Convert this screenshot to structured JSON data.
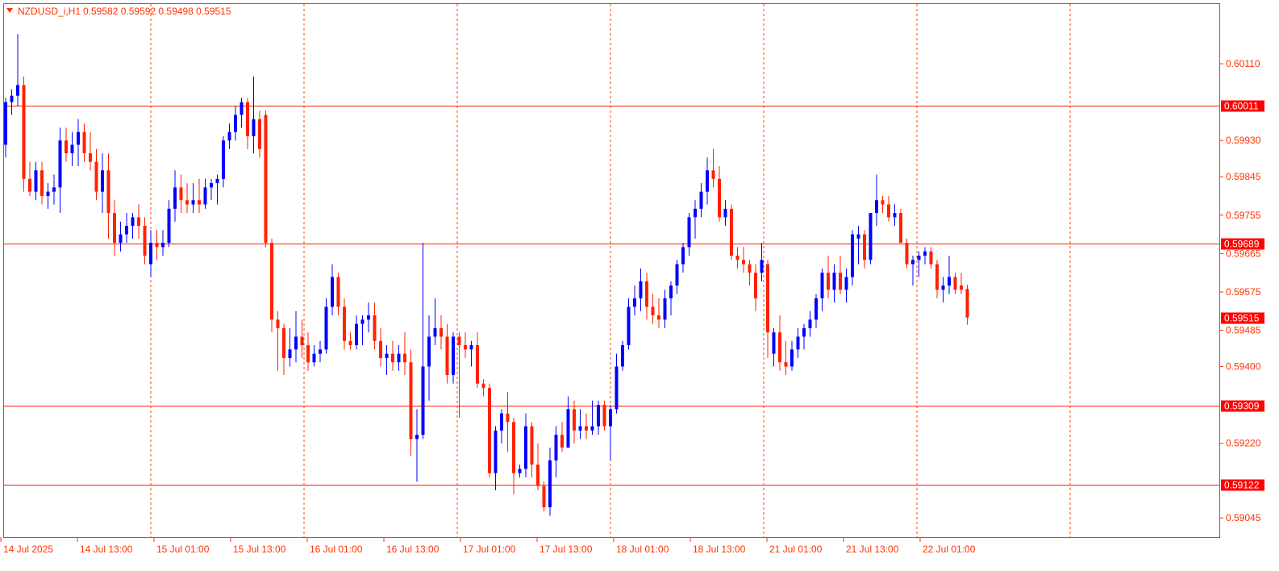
{
  "header": {
    "symbol": "NZDUSD_i,H1",
    "ohlc": "0.59582 0.59592 0.59498 0.59515"
  },
  "colors": {
    "frame": "#ff3300",
    "text": "#ff3300",
    "grid": "#ff4400",
    "bull": "#0000ff",
    "bear": "#ff2200",
    "level_line": "#ff2200",
    "level_label_bg": "#ff0000",
    "level_label_text": "#ffffff"
  },
  "chart_data": {
    "type": "candlestick",
    "timeframe": "H1",
    "ylim": [
      0.59,
      0.6025
    ],
    "y_ticks": [
      "0.60110",
      "0.59930",
      "0.59845",
      "0.59755",
      "0.59665",
      "0.59575",
      "0.59485",
      "0.59400",
      "0.59220",
      "0.59045"
    ],
    "x_labels": [
      "14 Jul 2025",
      "14 Jul 13:00",
      "15 Jul 01:00",
      "15 Jul 13:00",
      "16 Jul 01:00",
      "16 Jul 13:00",
      "17 Jul 01:00",
      "17 Jul 13:00",
      "18 Jul 01:00",
      "18 Jul 13:00",
      "21 Jul 01:00",
      "21 Jul 13:00",
      "22 Jul 01:00"
    ],
    "grid": "vertical dotted",
    "horizontal_levels": [
      {
        "label": "0.60011",
        "value": 0.60011
      },
      {
        "label": "0.59689",
        "value": 0.59689
      },
      {
        "label": "0.59309",
        "value": 0.59309
      },
      {
        "label": "0.59122",
        "value": 0.59122
      }
    ],
    "current_price": {
      "label": "0.59515",
      "value": 0.59515
    },
    "candles": [
      [
        0.5992,
        0.6003,
        0.5989,
        0.6002
      ],
      [
        0.6002,
        0.6005,
        0.5999,
        0.60035
      ],
      [
        0.60035,
        0.6018,
        0.6001,
        0.6006
      ],
      [
        0.6006,
        0.6008,
        0.5981,
        0.5984
      ],
      [
        0.5984,
        0.5988,
        0.598,
        0.5981
      ],
      [
        0.5981,
        0.5988,
        0.5979,
        0.5986
      ],
      [
        0.5986,
        0.5988,
        0.5978,
        0.598
      ],
      [
        0.598,
        0.5983,
        0.5977,
        0.5981
      ],
      [
        0.5981,
        0.5985,
        0.5978,
        0.5982
      ],
      [
        0.5982,
        0.5996,
        0.5976,
        0.5993
      ],
      [
        0.5993,
        0.5996,
        0.5988,
        0.599
      ],
      [
        0.599,
        0.5995,
        0.5987,
        0.5992
      ],
      [
        0.5992,
        0.5998,
        0.5987,
        0.5995
      ],
      [
        0.5995,
        0.5997,
        0.5988,
        0.599
      ],
      [
        0.599,
        0.5995,
        0.5986,
        0.5988
      ],
      [
        0.5988,
        0.5991,
        0.5979,
        0.5981
      ],
      [
        0.5981,
        0.599,
        0.5976,
        0.5986
      ],
      [
        0.5986,
        0.599,
        0.597,
        0.5976
      ],
      [
        0.5976,
        0.5979,
        0.5966,
        0.5969
      ],
      [
        0.5969,
        0.5974,
        0.5967,
        0.5971
      ],
      [
        0.5971,
        0.5976,
        0.5969,
        0.5973
      ],
      [
        0.5973,
        0.5976,
        0.597,
        0.5975
      ],
      [
        0.5975,
        0.5978,
        0.597,
        0.5973
      ],
      [
        0.5973,
        0.5975,
        0.5964,
        0.5966
      ],
      [
        0.5964,
        0.5972,
        0.5961,
        0.5969
      ],
      [
        0.5969,
        0.5972,
        0.5965,
        0.5968
      ],
      [
        0.5968,
        0.5972,
        0.5966,
        0.5969
      ],
      [
        0.5969,
        0.5979,
        0.5968,
        0.5977
      ],
      [
        0.5977,
        0.5986,
        0.5974,
        0.5982
      ],
      [
        0.5982,
        0.5985,
        0.5976,
        0.5979
      ],
      [
        0.5979,
        0.5983,
        0.5976,
        0.5978
      ],
      [
        0.5978,
        0.5983,
        0.5976,
        0.5979
      ],
      [
        0.5979,
        0.5984,
        0.5976,
        0.5978
      ],
      [
        0.5978,
        0.5984,
        0.5977,
        0.5982
      ],
      [
        0.5982,
        0.5984,
        0.5979,
        0.5983
      ],
      [
        0.5983,
        0.5985,
        0.5978,
        0.5984
      ],
      [
        0.5984,
        0.5994,
        0.5982,
        0.5993
      ],
      [
        0.5993,
        0.5997,
        0.5991,
        0.5995
      ],
      [
        0.5995,
        0.6001,
        0.5993,
        0.5999
      ],
      [
        0.5999,
        0.6003,
        0.5996,
        0.6002
      ],
      [
        0.6002,
        0.6003,
        0.5991,
        0.5994
      ],
      [
        0.5994,
        0.6008,
        0.599,
        0.5998
      ],
      [
        0.5998,
        0.6,
        0.5989,
        0.5991
      ],
      [
        0.5999,
        0.6,
        0.5968,
        0.5969
      ],
      [
        0.5969,
        0.597,
        0.5948,
        0.5951
      ],
      [
        0.5951,
        0.5953,
        0.5939,
        0.5949
      ],
      [
        0.5949,
        0.595,
        0.5938,
        0.5942
      ],
      [
        0.5942,
        0.5949,
        0.594,
        0.5944
      ],
      [
        0.5944,
        0.5953,
        0.5941,
        0.5947
      ],
      [
        0.5947,
        0.5951,
        0.5942,
        0.5945
      ],
      [
        0.5945,
        0.5948,
        0.5939,
        0.5941
      ],
      [
        0.5941,
        0.5945,
        0.594,
        0.5943
      ],
      [
        0.5943,
        0.5946,
        0.5941,
        0.5944
      ],
      [
        0.5944,
        0.5956,
        0.5943,
        0.5954
      ],
      [
        0.5954,
        0.5964,
        0.5952,
        0.5961
      ],
      [
        0.5961,
        0.5962,
        0.5952,
        0.5954
      ],
      [
        0.5954,
        0.5956,
        0.5944,
        0.5946
      ],
      [
        0.5946,
        0.5948,
        0.5944,
        0.5945
      ],
      [
        0.5945,
        0.5952,
        0.5944,
        0.595
      ],
      [
        0.595,
        0.5952,
        0.5945,
        0.5951
      ],
      [
        0.5951,
        0.5955,
        0.5948,
        0.5952
      ],
      [
        0.5952,
        0.5955,
        0.5944,
        0.5946
      ],
      [
        0.5946,
        0.5949,
        0.594,
        0.5942
      ],
      [
        0.5942,
        0.5945,
        0.5938,
        0.5943
      ],
      [
        0.5943,
        0.5946,
        0.5939,
        0.5941
      ],
      [
        0.5941,
        0.5945,
        0.5939,
        0.5943
      ],
      [
        0.5943,
        0.5948,
        0.5938,
        0.5941
      ],
      [
        0.5941,
        0.5944,
        0.5919,
        0.5923
      ],
      [
        0.5923,
        0.593,
        0.5913,
        0.5924
      ],
      [
        0.5924,
        0.5969,
        0.5923,
        0.594
      ],
      [
        0.594,
        0.5952,
        0.5932,
        0.5947
      ],
      [
        0.5947,
        0.5956,
        0.5945,
        0.5949
      ],
      [
        0.5949,
        0.5952,
        0.5944,
        0.5947
      ],
      [
        0.5947,
        0.595,
        0.5936,
        0.5938
      ],
      [
        0.5938,
        0.5948,
        0.5936,
        0.5947
      ],
      [
        0.5947,
        0.5948,
        0.5928,
        0.5945
      ],
      [
        0.5945,
        0.5948,
        0.5942,
        0.5944
      ],
      [
        0.5944,
        0.5946,
        0.594,
        0.5945
      ],
      [
        0.5945,
        0.5948,
        0.5935,
        0.5936
      ],
      [
        0.5936,
        0.5937,
        0.5933,
        0.5935
      ],
      [
        0.5935,
        0.5936,
        0.5914,
        0.5915
      ],
      [
        0.5915,
        0.5926,
        0.5911,
        0.5925
      ],
      [
        0.5925,
        0.593,
        0.5922,
        0.5929
      ],
      [
        0.5929,
        0.5934,
        0.592,
        0.5927
      ],
      [
        0.5927,
        0.5928,
        0.591,
        0.5915
      ],
      [
        0.5915,
        0.5917,
        0.5914,
        0.5916
      ],
      [
        0.5916,
        0.5929,
        0.5914,
        0.5926
      ],
      [
        0.5926,
        0.5927,
        0.5914,
        0.5917
      ],
      [
        0.5917,
        0.5922,
        0.5911,
        0.5912
      ],
      [
        0.5912,
        0.5913,
        0.5906,
        0.5907
      ],
      [
        0.5907,
        0.5921,
        0.5905,
        0.5918
      ],
      [
        0.5918,
        0.5926,
        0.5914,
        0.5924
      ],
      [
        0.5924,
        0.5927,
        0.592,
        0.5921
      ],
      [
        0.5921,
        0.5933,
        0.5921,
        0.593
      ],
      [
        0.593,
        0.5932,
        0.5922,
        0.5925
      ],
      [
        0.5925,
        0.593,
        0.5923,
        0.5926
      ],
      [
        0.5926,
        0.5929,
        0.5923,
        0.5925
      ],
      [
        0.5925,
        0.5932,
        0.5924,
        0.5926
      ],
      [
        0.5926,
        0.5932,
        0.5924,
        0.5931
      ],
      [
        0.5931,
        0.5932,
        0.5925,
        0.5926
      ],
      [
        0.5926,
        0.5931,
        0.5918,
        0.593
      ],
      [
        0.593,
        0.5943,
        0.5929,
        0.594
      ],
      [
        0.594,
        0.5946,
        0.5939,
        0.5945
      ],
      [
        0.5945,
        0.5956,
        0.5944,
        0.5954
      ],
      [
        0.5954,
        0.5959,
        0.5952,
        0.5956
      ],
      [
        0.5956,
        0.5963,
        0.5953,
        0.596
      ],
      [
        0.596,
        0.5962,
        0.5951,
        0.5954
      ],
      [
        0.5954,
        0.5957,
        0.595,
        0.5952
      ],
      [
        0.5952,
        0.5956,
        0.5949,
        0.5951
      ],
      [
        0.5951,
        0.5958,
        0.5949,
        0.5956
      ],
      [
        0.5956,
        0.596,
        0.5952,
        0.5959
      ],
      [
        0.5959,
        0.5965,
        0.5957,
        0.5964
      ],
      [
        0.5964,
        0.5969,
        0.5962,
        0.5968
      ],
      [
        0.5968,
        0.5976,
        0.5966,
        0.5975
      ],
      [
        0.5975,
        0.5979,
        0.597,
        0.5977
      ],
      [
        0.5977,
        0.5983,
        0.5975,
        0.5981
      ],
      [
        0.5981,
        0.5989,
        0.5978,
        0.5986
      ],
      [
        0.5986,
        0.5991,
        0.5982,
        0.5984
      ],
      [
        0.5984,
        0.5987,
        0.5974,
        0.5975
      ],
      [
        0.5975,
        0.5979,
        0.5973,
        0.5977
      ],
      [
        0.5977,
        0.5978,
        0.5965,
        0.5966
      ],
      [
        0.5966,
        0.5968,
        0.5963,
        0.5965
      ],
      [
        0.5965,
        0.5968,
        0.5962,
        0.5964
      ],
      [
        0.5964,
        0.5965,
        0.5959,
        0.5962
      ],
      [
        0.5962,
        0.5964,
        0.5953,
        0.5956
      ],
      [
        0.5962,
        0.5969,
        0.596,
        0.5965
      ],
      [
        0.5964,
        0.5965,
        0.5942,
        0.5948
      ],
      [
        0.5943,
        0.5949,
        0.594,
        0.5948
      ],
      [
        0.5948,
        0.5952,
        0.5939,
        0.5941
      ],
      [
        0.5941,
        0.5946,
        0.5938,
        0.594
      ],
      [
        0.594,
        0.5946,
        0.5939,
        0.5944
      ],
      [
        0.5944,
        0.5949,
        0.5942,
        0.5947
      ],
      [
        0.5947,
        0.595,
        0.5944,
        0.5949
      ],
      [
        0.5949,
        0.5953,
        0.5947,
        0.5951
      ],
      [
        0.5951,
        0.5957,
        0.5949,
        0.5956
      ],
      [
        0.5956,
        0.5963,
        0.5953,
        0.5962
      ],
      [
        0.5962,
        0.5966,
        0.5956,
        0.5958
      ],
      [
        0.5958,
        0.5964,
        0.5955,
        0.5962
      ],
      [
        0.5962,
        0.5966,
        0.5957,
        0.5958
      ],
      [
        0.5958,
        0.5963,
        0.5955,
        0.5961
      ],
      [
        0.5961,
        0.5972,
        0.5959,
        0.5971
      ],
      [
        0.597,
        0.5973,
        0.5964,
        0.5971
      ],
      [
        0.5971,
        0.5972,
        0.5963,
        0.5965
      ],
      [
        0.5965,
        0.5976,
        0.5964,
        0.5976
      ],
      [
        0.5976,
        0.5985,
        0.5973,
        0.5979
      ],
      [
        0.5979,
        0.598,
        0.5976,
        0.5978
      ],
      [
        0.5978,
        0.598,
        0.5974,
        0.5975
      ],
      [
        0.5975,
        0.5978,
        0.5973,
        0.5976
      ],
      [
        0.5976,
        0.5977,
        0.597,
        0.5969
      ],
      [
        0.5969,
        0.597,
        0.5963,
        0.5964
      ],
      [
        0.5964,
        0.5966,
        0.5959,
        0.5965
      ],
      [
        0.5965,
        0.5967,
        0.5961,
        0.5966
      ],
      [
        0.5966,
        0.5968,
        0.5964,
        0.5967
      ],
      [
        0.5967,
        0.5968,
        0.5963,
        0.5964
      ],
      [
        0.5964,
        0.5965,
        0.5956,
        0.5958
      ],
      [
        0.5958,
        0.5961,
        0.5955,
        0.5959
      ],
      [
        0.5959,
        0.5966,
        0.5957,
        0.5961
      ],
      [
        0.5961,
        0.5962,
        0.5957,
        0.5958
      ],
      [
        0.5959,
        0.5962,
        0.5957,
        0.5958
      ],
      [
        0.59582,
        0.59592,
        0.59498,
        0.59515
      ]
    ]
  }
}
